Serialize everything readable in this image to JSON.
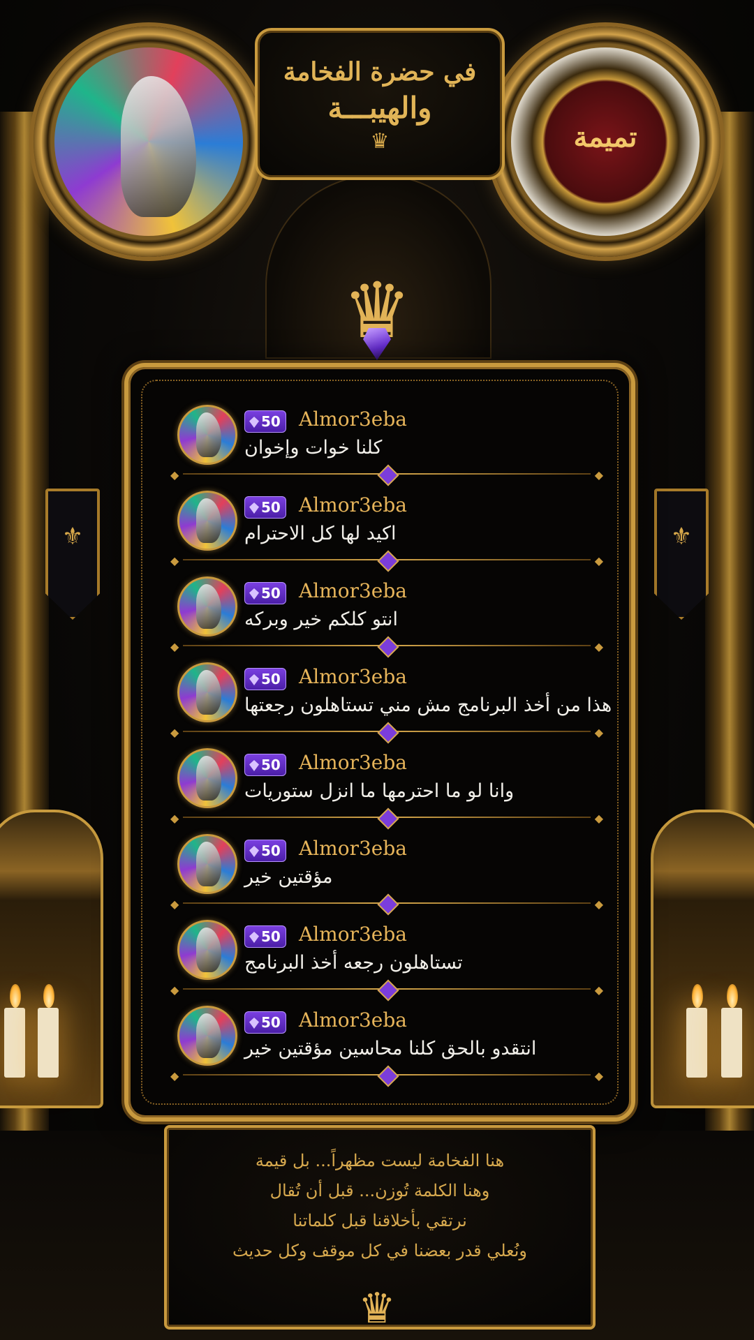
{
  "header": {
    "title_line1": "في حضرة الفخامة",
    "title_line2": "والهيبـــة",
    "crown_icon": "crown-icon"
  },
  "seal": {
    "text": "تميمة"
  },
  "chat": {
    "messages": [
      {
        "username": "Almor3eba",
        "badge_level": "50",
        "text": "كلنا خوات وإخوان"
      },
      {
        "username": "Almor3eba",
        "badge_level": "50",
        "text": "اكيد لها كل الاحترام"
      },
      {
        "username": "Almor3eba",
        "badge_level": "50",
        "text": "انتو كلكم خير وبركه"
      },
      {
        "username": "Almor3eba",
        "badge_level": "50",
        "text": "هذا من أخذ البرنامج مش مني تستاهلون رجعتها"
      },
      {
        "username": "Almor3eba",
        "badge_level": "50",
        "text": "وانا لو ما احترمها ما انزل ستوريات"
      },
      {
        "username": "Almor3eba",
        "badge_level": "50",
        "text": "مؤقتين خير"
      },
      {
        "username": "Almor3eba",
        "badge_level": "50",
        "text": "تستاهلون رجعه أخذ البرنامج"
      },
      {
        "username": "Almor3eba",
        "badge_level": "50",
        "text": "انتقدو بالحق كلنا محاسين مؤقتين خير"
      }
    ]
  },
  "quote": {
    "lines": [
      "هنا الفخامة ليست مظهراً... بل قيمة",
      "وهنا الكلمة تُوزن... قبل أن تُقال",
      "نرتقي بأخلاقنا قبل كلماتنا",
      "ونُعلي قدر بعضنا في كل موقف وكل حديث"
    ]
  },
  "colors": {
    "gold": "#c99a3e",
    "badge_purple": "#5b25c0",
    "username_gold": "#e6b45a",
    "background": "#050403"
  }
}
